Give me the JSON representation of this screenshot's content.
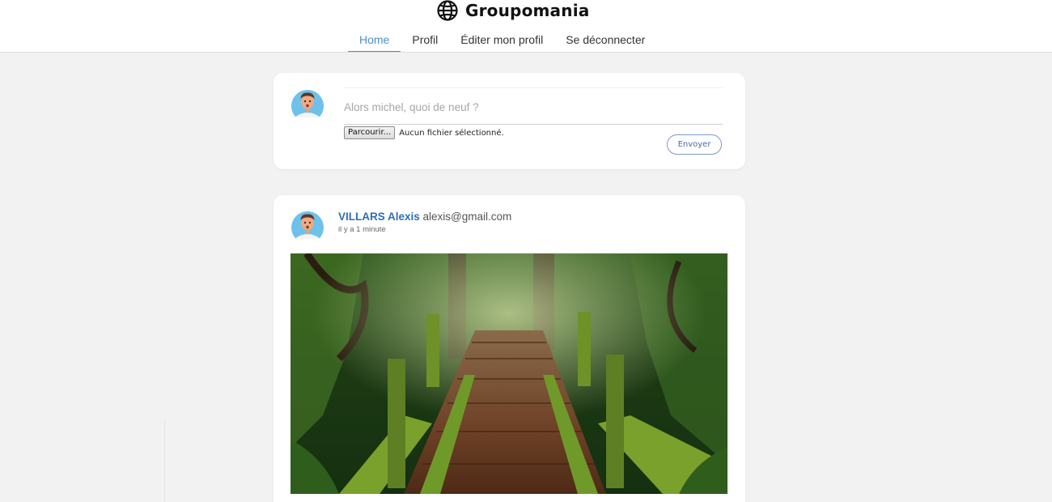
{
  "app": {
    "name": "Groupomania",
    "logo_icon": "globe-icon"
  },
  "nav": {
    "items": [
      {
        "label": "Home",
        "active": true
      },
      {
        "label": "Profil",
        "active": false
      },
      {
        "label": "Éditer mon profil",
        "active": false
      },
      {
        "label": "Se déconnecter",
        "active": false
      }
    ]
  },
  "composer": {
    "placeholder": "Alors michel, quoi de neuf ?",
    "value": "",
    "browse_label": "Parcourir...",
    "file_status": "Aucun fichier sélectionné.",
    "send_label": "Envoyer"
  },
  "post": {
    "author_name": "VILLARS Alexis",
    "author_email": "alexis@gmail.com",
    "time": "il y a 1 minute",
    "image_subject": "mossy wooden footbridge in a rainforest"
  },
  "colors": {
    "accent": "#4a90c8",
    "author_link": "#2f6eb5",
    "page_bg": "#f2f2f2",
    "card_bg": "#ffffff",
    "send_border": "#7f98c7"
  }
}
